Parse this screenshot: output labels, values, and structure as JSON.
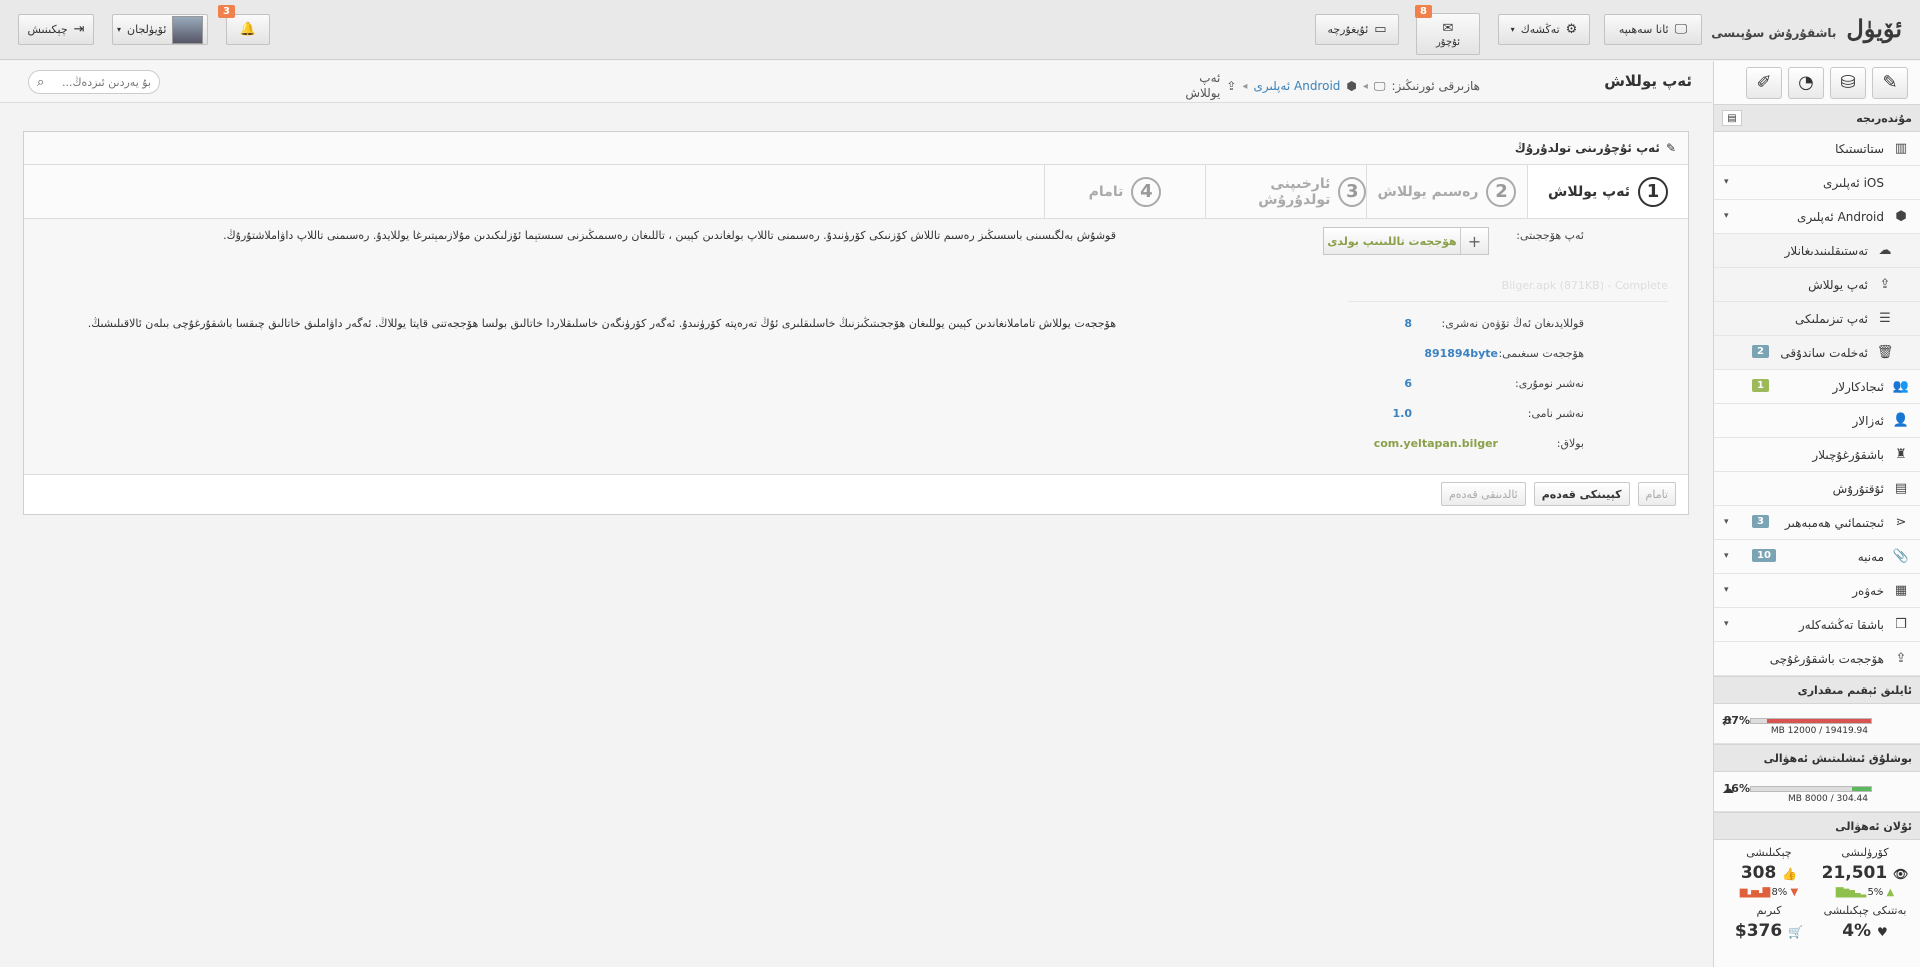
{
  "header": {
    "brand": "ئۆيۈل",
    "brand_sub": "باشقۇرۇش سۇپىسى",
    "home_btn": "ئانا سەھىپە",
    "settings_btn": "تەڭشەك",
    "messages_btn": "ئۇچۇر",
    "messages_badge": "8",
    "board_btn": "ئۇيغۇرچە",
    "notif_badge": "3",
    "user_btn": "ئۆيۈلجان",
    "logout_btn": "چېكىنىش"
  },
  "breadcrumb": {
    "page_title": "ئەپ يوللاش",
    "current_label": "ھازىرقى ئورنىڭىز:",
    "level1": "Android ئەپلىرى",
    "level2": "ئەپ يوللاش"
  },
  "search": {
    "placeholder": "بۇ يەردىن ئىزدەڭ..."
  },
  "sidebar": {
    "section_title": "مۇندەرىجە",
    "items": [
      {
        "label": "ستاتستىكا",
        "icon": "chart-icon"
      },
      {
        "label": "iOS ئەپلىرى",
        "icon": "apple-icon"
      },
      {
        "label": "Android ئەپلىرى",
        "icon": "android-icon"
      },
      {
        "label": "تەستىقلىنىدىغانلار",
        "icon": "cloud-icon"
      },
      {
        "label": "ئەپ يوللاش",
        "icon": "upload-icon"
      },
      {
        "label": "ئەپ تىزىملىكى",
        "icon": "list-icon"
      },
      {
        "label": "ئەخلەت ساندۇقى",
        "icon": "trash-icon",
        "count": "2"
      },
      {
        "label": "ئىجادكارلار",
        "icon": "users-icon",
        "count": "1"
      },
      {
        "label": "ئەزالار",
        "icon": "user-icon"
      },
      {
        "label": "باشقۇرغۇچىلار",
        "icon": "admin-icon"
      },
      {
        "label": "ئۇقتۇرۇش",
        "icon": "news-icon"
      },
      {
        "label": "ئىجتىمائىي ھەمبەھىر",
        "icon": "share-icon",
        "count": "3"
      },
      {
        "label": "مەنبە",
        "icon": "paperclip-icon",
        "count": "10"
      },
      {
        "label": "خەۋەر",
        "icon": "newspaper-icon"
      },
      {
        "label": "باشقا تەڭشەكلەر",
        "icon": "cube-icon"
      },
      {
        "label": "ھۆججەت باشقۇرغۇچى",
        "icon": "upload-tray-icon"
      }
    ],
    "traffic": {
      "title": "ئايلىق ئېقىم مىقدارى",
      "percent": "87%",
      "fraction": 0.87,
      "text": "MB 12000 / 19419.94"
    },
    "storage": {
      "title": "بوشلۇق ئىشلىتىش ئەھۋالى",
      "percent": "16%",
      "fraction": 0.16,
      "text": "MB 8000 / 304.44"
    },
    "overview": {
      "title": "ئۇلان ئەھۋالى",
      "views_label": "كۆرۈلىشى",
      "clicks_label": "چېكىلىشى",
      "views": "21,501",
      "clicks": "308",
      "views_change": "5%",
      "clicks_change": "8%",
      "rate_label": "بەتتىكى چېكىلىشى",
      "income_label": "كىرىم",
      "rate": "4%",
      "income": "$376"
    }
  },
  "panel": {
    "title": "ئەپ ئۇچۇرىنى تولدۇرۇڭ",
    "steps": [
      {
        "num": "1",
        "label": "ئەپ يوللاش"
      },
      {
        "num": "2",
        "label": "رەسىم يوللاش"
      },
      {
        "num": "3",
        "label": "ئارخىپنى تولدۇرۇش"
      },
      {
        "num": "4",
        "label": "تامام"
      }
    ],
    "file_label": "ئەپ ھۆججىتى:",
    "file_button": "ھۆججەت تاللىنىپ بولدى",
    "ghost_text": "Bilger.apk (871KB) - Complete",
    "hint1": "قوشۇش بەلگىسىنى باسسىڭىز رەسىم تاللاش كۆزنىكى كۆرۈنىدۇ. رەسىمنى تاللاپ بولغاندىن كېيىن ، تاللىغان رەسىمىڭىزنى سىستېما ئۆزلىكىدىن مۇلازىمېتىرغا يوللايدۇ. رەسىمنى تاللاپ داۋاملاشتۇرۇڭ.",
    "hint2": "ھۆججەت يوللاش تاماملانغاندىن كېيىن يوللىغان ھۆججىتىڭىزنىڭ خاسلىقلىرى ئۇڭ تەرەپتە كۆرۈنىدۇ. ئەگەر كۆرۈنگەن خاسلىقلاردا خاتالىق بولسا ھۆججەتنى قايتا يوللاڭ. ئەگەر داۋاملىق خاتالىق چىقسا باشقۇرغۇچى بىلەن ئالاقىلىشىڭ.",
    "fields": [
      {
        "label": "قوللايدىغان ئەڭ تۆۋەن نەشرى:",
        "value": "8"
      },
      {
        "label": "ھۆججەت سىغىمى:",
        "value": "891894byte"
      },
      {
        "label": "نەشىر نومۇرى:",
        "value": "6"
      },
      {
        "label": "نەشىر نامى:",
        "value": "1.0"
      },
      {
        "label": "بولاق:",
        "value": "com.yeltapan.bilger"
      }
    ],
    "btn_prev": "ئالدىنقى قەدەم",
    "btn_next": "كېيىنكى قەدەم",
    "btn_finish": "تامام"
  },
  "colors": {
    "accent_blue": "#3a82c1",
    "accent_green": "#8aa04a",
    "badge_orange": "#f0814c",
    "traffic_bar": "#d9534f",
    "storage_bar": "#5cb85c"
  }
}
